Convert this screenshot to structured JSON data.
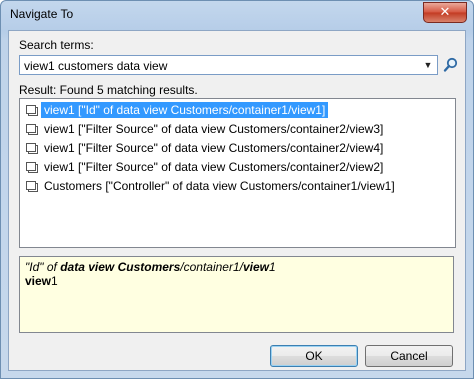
{
  "window": {
    "title": "Navigate To",
    "close_symbol": "✕"
  },
  "search": {
    "label": "Search terms:",
    "value": "view1 customers data view"
  },
  "results": {
    "label": "Result: Found 5 matching results.",
    "items": [
      {
        "label": "view1 [\"Id\" of data view Customers/container1/view1]",
        "selected": true
      },
      {
        "label": "view1 [\"Filter Source\" of data view Customers/container2/view3]",
        "selected": false
      },
      {
        "label": "view1 [\"Filter Source\" of data view Customers/container2/view4]",
        "selected": false
      },
      {
        "label": "view1 [\"Filter Source\" of data view Customers/container2/view2]",
        "selected": false
      },
      {
        "label": "Customers [\"Controller\" of data view Customers/container1/view1]",
        "selected": false
      }
    ]
  },
  "details": {
    "line1": [
      {
        "text": "\"Id\"",
        "style": "italic"
      },
      {
        "text": " of ",
        "style": "italic"
      },
      {
        "text": "data view Customers",
        "style": "bold-italic"
      },
      {
        "text": "/container1/",
        "style": "italic"
      },
      {
        "text": "view",
        "style": "bold-italic"
      },
      {
        "text": "1",
        "style": "italic"
      }
    ],
    "line2": [
      {
        "text": "view",
        "style": "bold"
      },
      {
        "text": "1",
        "style": "normal"
      }
    ]
  },
  "buttons": {
    "ok": "OK",
    "cancel": "Cancel"
  },
  "colors": {
    "selection": "#3399ff",
    "details_bg": "#ffffe1",
    "close_button": "#c23a22"
  }
}
